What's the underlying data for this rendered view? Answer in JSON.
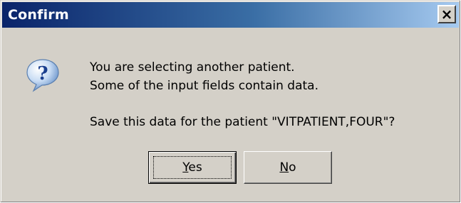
{
  "window": {
    "title": "Confirm",
    "close_glyph": "×"
  },
  "icon": {
    "name": "question-icon",
    "glyph": "?"
  },
  "message": {
    "line1": "You are selecting another patient.",
    "line2": "Some of the input fields contain data.",
    "line3": "Save this data for the patient \"VITPATIENT,FOUR\"?"
  },
  "buttons": {
    "yes": {
      "accel": "Y",
      "rest": "es",
      "focused": true
    },
    "no": {
      "accel": "N",
      "rest": "o",
      "focused": false
    }
  },
  "colors": {
    "title_gradient_start": "#0a246a",
    "title_gradient_end": "#a6caf0",
    "dialog_face": "#d4d0c8"
  }
}
